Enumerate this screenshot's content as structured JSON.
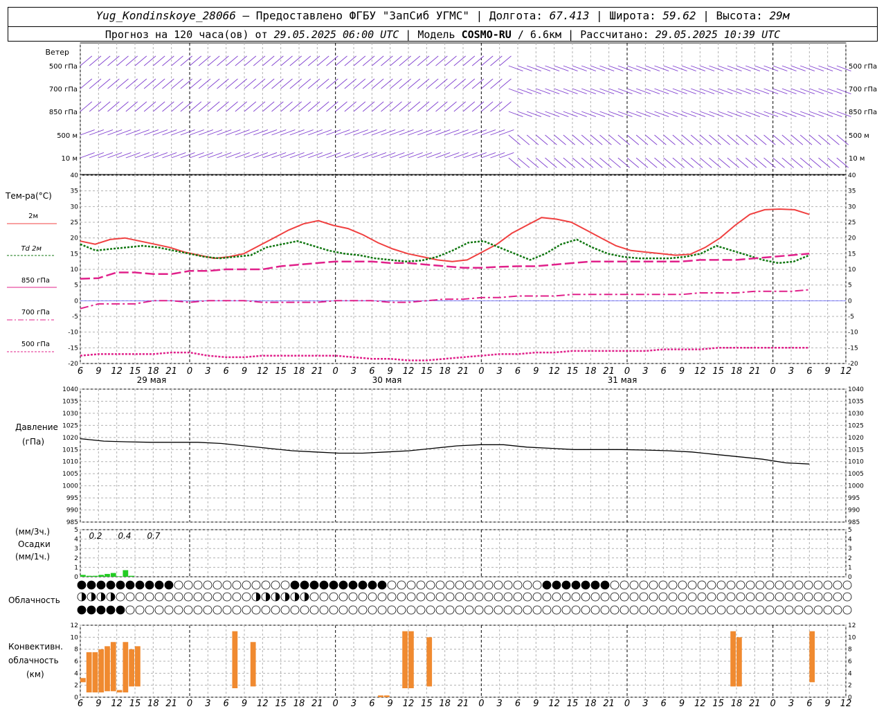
{
  "header": {
    "station": "Yug_Kondinskoye_28066",
    "provider": "– Предоставлено ФГБУ \"ЗапСиб УГМС\"",
    "lon_label": "Долгота:",
    "lon": "67.413",
    "lat_label": "Широта:",
    "lat": "59.62",
    "alt_label": "Высота:",
    "alt": "29м",
    "forecast_label": "Прогноз на 120 часа(ов) от",
    "forecast_from": "29.05.2025 06:00 UTC",
    "model_label": "Модель",
    "model": "COSMO-RU",
    "model_res": "/ 6.6км",
    "calc_label": "Рассчитано:",
    "calc_time": "29.05.2025 10:39 UTC"
  },
  "labels": {
    "wind": "Ветер",
    "wind_levels": [
      "500 гПа",
      "700 гПа",
      "850 гПа",
      "500 м",
      "10 м"
    ],
    "temp_title": "Тем-ра(°С)",
    "temp_legend": [
      "2м",
      "Td 2м",
      "850 гПа",
      "700 гПа",
      "500 гПа"
    ],
    "pressure_title": "Давление",
    "pressure_unit": "(гПа)",
    "precip_unit1": "(мм/3ч.)",
    "precip_title": "Осадки",
    "precip_unit2": "(мм/1ч.)",
    "clouds_title": "Облачность",
    "conv_title1": "Конвективн.",
    "conv_title2": "облачность",
    "conv_unit": "(км)",
    "dates": [
      "29 мая",
      "30 мая",
      "31 мая"
    ]
  },
  "colors": {
    "t2m": "#f04040",
    "td2m": "#117711",
    "t850": "#e0208a",
    "t700": "#e0208a",
    "t500": "#e0208a",
    "wind": "#8040d0",
    "precip": "#22cc22",
    "conv": "#f08a30",
    "grid": "#b0b0b0"
  },
  "chart_data": [
    {
      "type": "line",
      "name": "temperature",
      "x_hours": [
        0,
        3,
        6,
        9,
        12,
        15,
        18,
        21,
        24,
        27,
        30,
        33,
        36,
        39,
        42,
        45,
        48,
        51,
        54,
        57,
        60,
        63,
        66,
        69,
        72,
        75,
        78,
        81,
        84,
        87,
        90,
        93,
        96,
        99,
        102,
        105,
        108,
        111,
        114,
        117,
        120
      ],
      "x_ticks": [
        "6",
        "9",
        "12",
        "15",
        "18",
        "21",
        "0",
        "3",
        "6",
        "9",
        "12",
        "15",
        "18",
        "21",
        "0",
        "3",
        "6",
        "9",
        "12",
        "15",
        "18",
        "21",
        "0",
        "3",
        "6",
        "9",
        "12",
        "15",
        "18",
        "21",
        "0",
        "3",
        "6",
        "9",
        "12",
        "15",
        "18",
        "21",
        "0",
        "3",
        "6",
        "9",
        "12"
      ],
      "ylim": [
        -20,
        40
      ],
      "yticks": [
        -20,
        -15,
        -10,
        -5,
        0,
        5,
        10,
        15,
        20,
        25,
        30,
        35,
        40
      ],
      "series": [
        {
          "name": "2м",
          "values": [
            19,
            18,
            19.5,
            20,
            19,
            18,
            17,
            15.5,
            14.5,
            13.5,
            14,
            15,
            17.5,
            20,
            22.5,
            24.5,
            25.5,
            24,
            23,
            21,
            18.5,
            16.5,
            15,
            14,
            13,
            12.5,
            13,
            15.5,
            18,
            21.5,
            24,
            26.5,
            26,
            25,
            22.5,
            20,
            17.5,
            16,
            15.5,
            15,
            14.5,
            14.8,
            17,
            20,
            24,
            27.5,
            29,
            29.2,
            29,
            27.5
          ]
        },
        {
          "name": "Td 2м",
          "values": [
            18,
            16,
            16.5,
            17,
            17.5,
            17,
            16,
            15,
            14,
            13.5,
            14,
            14.5,
            17,
            18,
            19,
            17.5,
            16,
            15,
            14.5,
            13.5,
            13,
            12.5,
            12.8,
            14,
            16,
            18.5,
            19,
            17,
            15,
            13,
            15,
            18,
            19.5,
            17,
            15,
            14,
            13.5,
            13.5,
            13.5,
            14,
            15,
            17.5,
            16,
            14.5,
            13,
            12,
            12.5,
            14.5
          ]
        },
        {
          "name": "850 гПа",
          "values": [
            7,
            7.2,
            9,
            9,
            8.5,
            8.5,
            9.5,
            9.5,
            10,
            10,
            10,
            11,
            11.5,
            12,
            12.5,
            12.5,
            12.5,
            12,
            12,
            11.5,
            11,
            10.5,
            10.5,
            10.8,
            11,
            11,
            11.5,
            12,
            12.5,
            12.5,
            12.5,
            12.5,
            12.5,
            12.5,
            13,
            13,
            13,
            13.5,
            14,
            14.5,
            15
          ]
        },
        {
          "name": "700 гПа",
          "values": [
            -2.5,
            -1,
            -1,
            -1,
            0,
            0,
            -0.5,
            0,
            0,
            0,
            -0.5,
            -0.5,
            -0.5,
            -0.5,
            0,
            0,
            0,
            -0.5,
            -0.5,
            0,
            0.5,
            0.5,
            1,
            1,
            1.5,
            1.5,
            1.5,
            2,
            2,
            2,
            2,
            2,
            2,
            2,
            2.5,
            2.5,
            2.5,
            3,
            3,
            3,
            3.5
          ]
        },
        {
          "name": "500 гПа",
          "values": [
            -17.5,
            -17,
            -17,
            -17,
            -17,
            -16.5,
            -16.5,
            -17.5,
            -18,
            -18,
            -17.5,
            -17.5,
            -17.5,
            -17.5,
            -17.5,
            -18,
            -18.5,
            -18.5,
            -19,
            -19,
            -18.5,
            -18,
            -17.5,
            -17,
            -17,
            -16.5,
            -16.5,
            -16,
            -16,
            -16,
            -16,
            -16,
            -15.5,
            -15.5,
            -15.5,
            -15,
            -15,
            -15,
            -15,
            -15,
            -15
          ]
        }
      ]
    },
    {
      "type": "line",
      "name": "pressure",
      "ylim": [
        985,
        1040
      ],
      "yticks": [
        985,
        990,
        995,
        1000,
        1005,
        1010,
        1015,
        1020,
        1025,
        1030,
        1035,
        1040
      ],
      "values": [
        1019.5,
        1018.5,
        1018.2,
        1018,
        1018,
        1018,
        1017.5,
        1016.5,
        1015.5,
        1014.5,
        1014,
        1013.5,
        1013.5,
        1014,
        1014.5,
        1015.5,
        1016.5,
        1017,
        1017,
        1016,
        1015.5,
        1015,
        1015,
        1015,
        1014.8,
        1014.5,
        1014,
        1013,
        1012,
        1011,
        1009.5,
        1009
      ]
    },
    {
      "type": "bar",
      "name": "precipitation",
      "ylim": [
        0,
        5
      ],
      "yticks": [
        0,
        1,
        2,
        3,
        4,
        5
      ],
      "annotations": [
        "0.2",
        "0.4",
        "0.7"
      ],
      "values_1h": [
        0.2,
        0.1,
        0.1,
        0.2,
        0.3,
        0.4,
        0.05,
        0.7,
        0.1,
        0,
        0,
        0
      ]
    },
    {
      "type": "bar",
      "name": "convective_clouds",
      "ylim": [
        0,
        12
      ],
      "yticks": [
        0,
        2,
        4,
        6,
        8,
        10,
        12
      ],
      "bars": [
        {
          "h": 0,
          "base": 2.5,
          "top": 3.2
        },
        {
          "h": 1,
          "base": 0.8,
          "top": 7.5
        },
        {
          "h": 2,
          "base": 0.8,
          "top": 7.5
        },
        {
          "h": 3,
          "base": 0.8,
          "top": 8
        },
        {
          "h": 4,
          "base": 1.0,
          "top": 8.5
        },
        {
          "h": 5,
          "base": 1.0,
          "top": 9.2
        },
        {
          "h": 6,
          "base": 0.8,
          "top": 1.2
        },
        {
          "h": 7,
          "base": 0.8,
          "top": 9.2
        },
        {
          "h": 8,
          "base": 1.8,
          "top": 8
        },
        {
          "h": 9,
          "base": 1.8,
          "top": 8.5
        },
        {
          "h": 25,
          "base": 1.5,
          "top": 11
        },
        {
          "h": 28,
          "base": 1.8,
          "top": 9.2
        },
        {
          "h": 49,
          "base": 0,
          "top": 0.3
        },
        {
          "h": 50,
          "base": 0,
          "top": 0.3
        },
        {
          "h": 53,
          "base": 1.5,
          "top": 11
        },
        {
          "h": 54,
          "base": 1.5,
          "top": 11
        },
        {
          "h": 57,
          "base": 1.8,
          "top": 10
        },
        {
          "h": 107,
          "base": 1.8,
          "top": 11
        },
        {
          "h": 108,
          "base": 1.8,
          "top": 10
        },
        {
          "h": 120,
          "base": 2.5,
          "top": 11
        }
      ]
    }
  ]
}
